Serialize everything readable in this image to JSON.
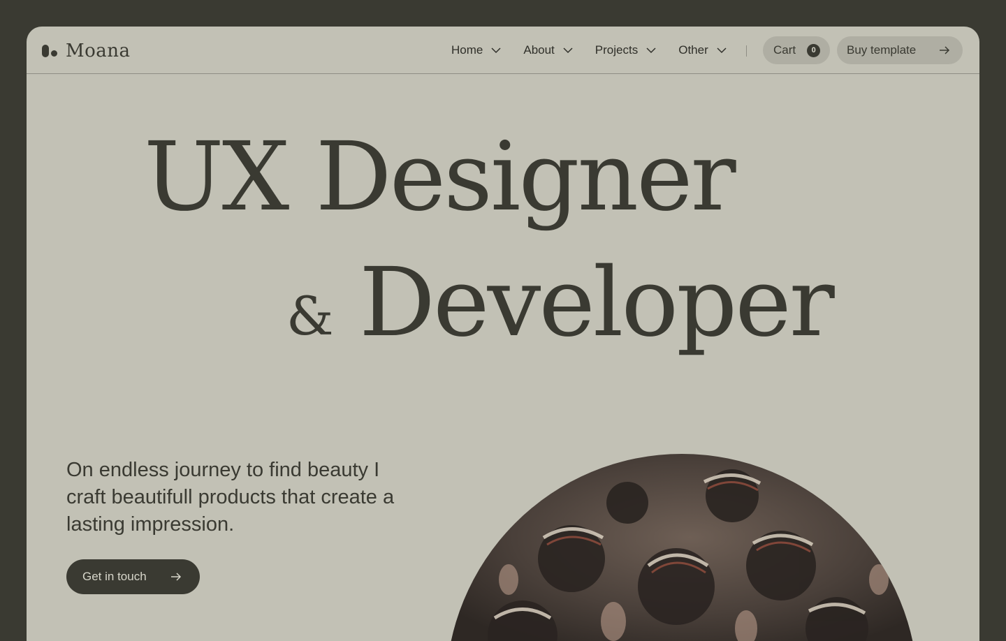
{
  "nav": {
    "logo_text": "Moana",
    "menu": [
      {
        "label": "Home"
      },
      {
        "label": "About"
      },
      {
        "label": "Projects"
      },
      {
        "label": "Other"
      }
    ],
    "cart_label": "Cart",
    "cart_count": "0",
    "buy_label": "Buy template"
  },
  "hero": {
    "line1": "UX Designer",
    "ampersand": "&",
    "line2": "Developer",
    "tagline": "On endless journey to find beauty I craft beautifull products that create a lasting impression.",
    "cta_label": "Get in touch"
  },
  "colors": {
    "page_background": "#3a3a32",
    "frame_background": "#c2c1b5",
    "text": "#3a3a32",
    "pill_button": "#afaea3"
  }
}
